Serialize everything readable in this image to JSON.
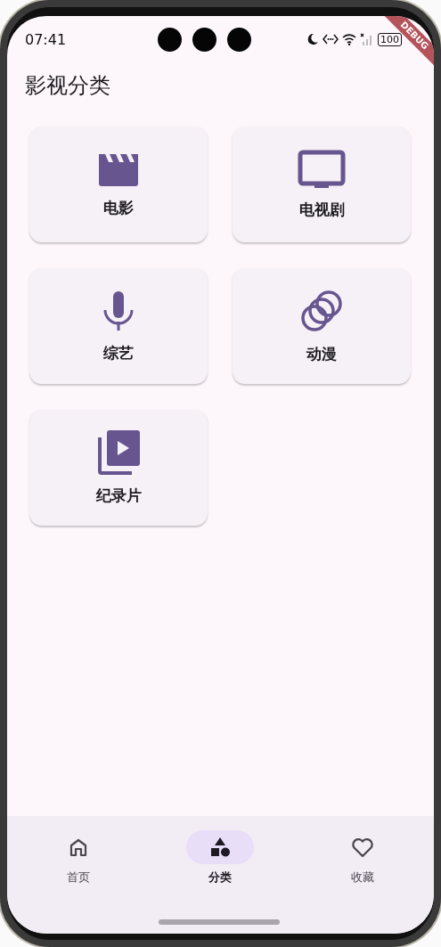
{
  "status_bar": {
    "time": "07:41",
    "battery": "100"
  },
  "debug_banner": "DEBUG",
  "app_bar": {
    "title": "影视分类"
  },
  "categories": [
    {
      "label": "电影",
      "kind": "movie"
    },
    {
      "label": "电视剧",
      "kind": "tv"
    },
    {
      "label": "综艺",
      "kind": "mic"
    },
    {
      "label": "动漫",
      "kind": "rings"
    },
    {
      "label": "纪录片",
      "kind": "video-library"
    }
  ],
  "nav": [
    {
      "label": "首页",
      "kind": "home",
      "selected": false
    },
    {
      "label": "分类",
      "kind": "shapes",
      "selected": true
    },
    {
      "label": "收藏",
      "kind": "heart",
      "selected": false
    }
  ]
}
